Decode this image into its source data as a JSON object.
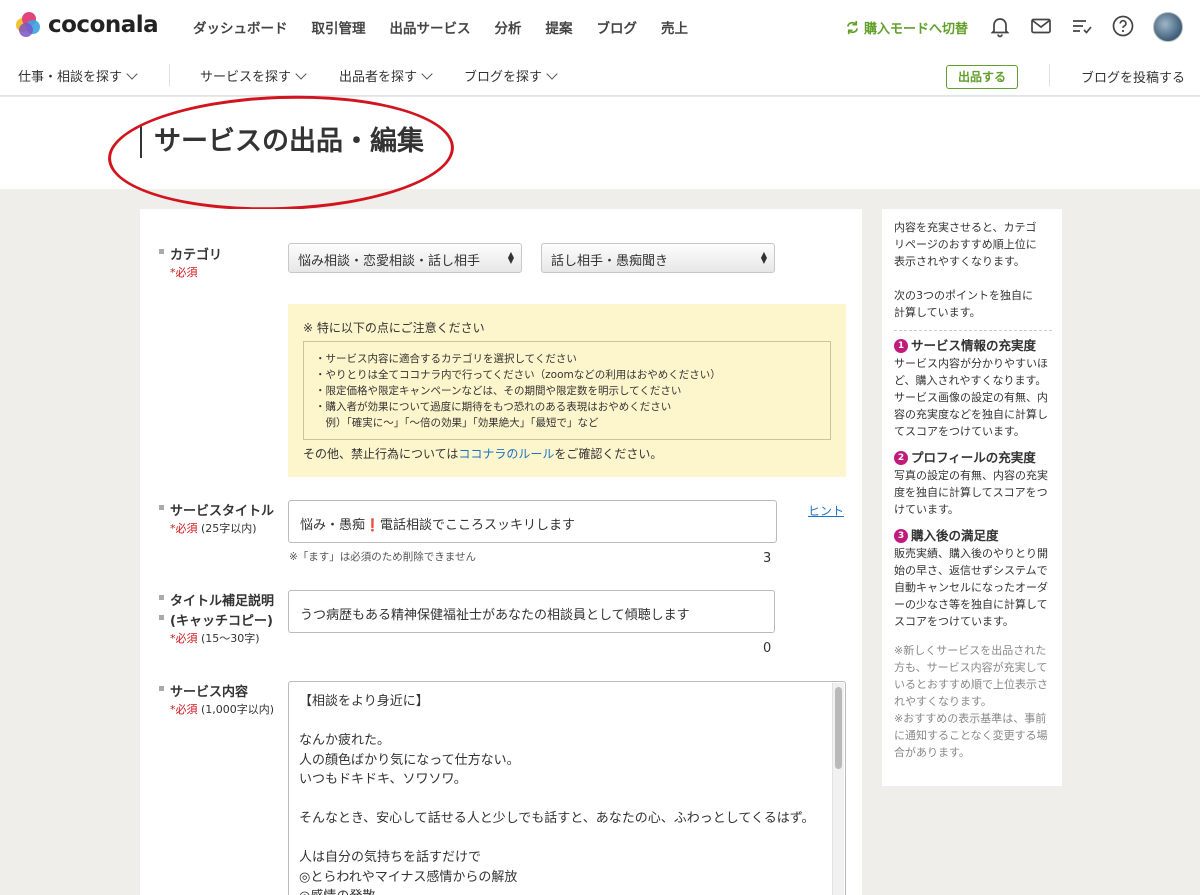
{
  "header": {
    "logo_text": "coconala",
    "nav": [
      "ダッシュボード",
      "取引管理",
      "出品サービス",
      "分析",
      "提案",
      "ブログ",
      "売上"
    ],
    "buyer_mode": "購入モードへ切替",
    "icons": [
      "bell-icon",
      "mail-icon",
      "todo-list-icon",
      "help-icon"
    ]
  },
  "subnav": {
    "items": [
      "仕事・相談を探す",
      "サービスを探す",
      "出品者を探す",
      "ブログを探す"
    ],
    "post_button": "出品する",
    "blog_post": "ブログを投稿する"
  },
  "page": {
    "title": "サービスの出品・編集"
  },
  "form": {
    "category": {
      "label": "カテゴリ",
      "required": "*必須",
      "primary": "悩み相談・恋愛相談・話し相手",
      "secondary": "話し相手・愚痴聞き"
    },
    "notice": {
      "head": "※ 特に以下の点にご注意ください",
      "items": [
        "・サービス内容に適合するカテゴリを選択してください",
        "・やりとりは全てココナラ内で行ってください（zoomなどの利用はおやめください）",
        "・限定価格や限定キャンペーンなどは、その期間や限定数を明示してください",
        "・購入者が効果について過度に期待をもつ恐れのある表現はおやめください",
        "　例）「確実に〜」「〜倍の効果」「効果絶大」「最短で」など"
      ],
      "foot_pre": "その他、禁止行為については",
      "foot_link": "ココナラのルール",
      "foot_post": "をご確認ください。"
    },
    "title": {
      "label": "サービスタイトル",
      "required": "*必須",
      "limit": "(25字以内)",
      "value_pre": "悩み・愚痴",
      "value_mark": "❗",
      "value_post": "電話相談でこころスッキリします",
      "hint": "ヒント",
      "note": "※「ます」は必須のため削除できません",
      "count": "3"
    },
    "catch": {
      "label1": "タイトル補足説明",
      "label2": "(キャッチコピー)",
      "required": "*必須",
      "limit": "(15〜30字)",
      "value": "うつ病歴もある精神保健福祉士があなたの相談員として傾聴します",
      "count": "0"
    },
    "content": {
      "label": "サービス内容",
      "required": "*必須",
      "limit": "(1,000字以内)",
      "lines": [
        "【相談をより身近に】",
        "",
        "なんか疲れた。",
        "人の顔色ばかり気になって仕方ない。",
        "いつもドキドキ、ソワソワ。",
        "",
        "そんなとき、安心して話せる人と少しでも話すと、あなたの心、ふわっとしてくるはず。",
        "",
        "人は自分の気持ちを話すだけで",
        "◎とらわれやマイナス感情からの解放",
        "◎感情の発散"
      ]
    }
  },
  "side": {
    "intro1": [
      "内容を充実させると、カテゴ",
      "リページのおすすめ順上位に",
      "表示されやすくなります。"
    ],
    "intro2": [
      "次の3つのポイントを独自に",
      "計算しています。"
    ],
    "points": [
      {
        "num": "1",
        "title": "サービス情報の充実度",
        "lines": [
          "サービス内容が分かりやすいほ",
          "ど、購入されやすくなります。",
          "サービス画像の設定の有無、内",
          "容の充実度などを独自に計算し",
          "てスコアをつけています。"
        ]
      },
      {
        "num": "2",
        "title": "プロフィールの充実度",
        "lines": [
          "写真の設定の有無、内容の充実",
          "度を独自に計算してスコアをつ",
          "けています。"
        ]
      },
      {
        "num": "3",
        "title": "購入後の満足度",
        "lines": [
          "販売実績、購入後のやりとり開",
          "始の早さ、返信せずシステムで",
          "自動キャンセルになったオーダ",
          "ーの少なさ等を独自に計算して",
          "スコアをつけています。"
        ]
      }
    ],
    "footnote": [
      "※新しくサービスを出品された",
      "方も、サービス内容が充実して",
      "いるとおすすめ順で上位表示さ",
      "れやすくなります。",
      "※おすすめの表示基準は、事前",
      "に通知することなく変更する場",
      "合があります。"
    ]
  },
  "colors": {
    "brand_green": "#62a02b",
    "link_blue": "#1a73c4",
    "required_red": "#d1141d",
    "annotation_red": "#d1141d",
    "notice_bg": "#fdf5cc",
    "point_badge": "#c01a7a"
  }
}
